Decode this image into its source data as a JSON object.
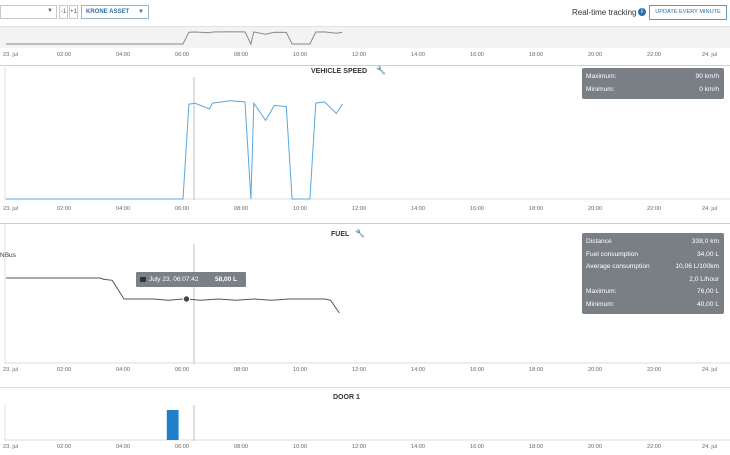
{
  "toolbar": {
    "minus_label": "-1",
    "plus_label": "+1",
    "asset_label": "KRONE ASSET",
    "realtime_label": "Real-time tracking",
    "update_label": "UPDATE EVERY MINUTE",
    "icons": {
      "dropdown": "chevron-down-icon",
      "info": "info-icon",
      "settings": "wrench-icon"
    }
  },
  "axis_ticks": [
    "23. jul",
    "02:00",
    "04:00",
    "06:00",
    "08:00",
    "10:00",
    "12:00",
    "14:00",
    "16:00",
    "18:00",
    "20:00",
    "22:00",
    "24. jul"
  ],
  "speed_panel": {
    "title": "VEHICLE SPEED",
    "stats": [
      {
        "label": "Maximum:",
        "value": "90 km/h"
      },
      {
        "label": "Minimum:",
        "value": "0 km/h"
      }
    ]
  },
  "fuel_panel": {
    "title": "FUEL",
    "series_label": "NBus",
    "tooltip": {
      "date": "July 23, 06:07:42",
      "value": "58,00 L"
    },
    "stats": [
      {
        "label": "Distance",
        "value": "338,0 km"
      },
      {
        "label": "Fuel consumption",
        "value": "34,00 L"
      },
      {
        "label": "Average consumption",
        "value": "10,06 L/100km"
      },
      {
        "label": "",
        "value": "2,0 L/hour"
      },
      {
        "label": "Maximum:",
        "value": "76,00 L"
      },
      {
        "label": "Minimum:",
        "value": "40,00 L"
      }
    ]
  },
  "door_panel": {
    "title": "DOOR 1"
  },
  "colors": {
    "speed_line": "#5aa7e0",
    "fuel_line": "#555555",
    "door_bar": "#1f7fc9",
    "stat_bg": "#7a7f86",
    "accent": "#2a6fae"
  },
  "chart_data": [
    {
      "type": "line",
      "title": "VEHICLE SPEED",
      "unit": "km/h",
      "x_range": [
        "23. jul 00:00",
        "24. jul 00:00"
      ],
      "ylim": [
        0,
        90
      ],
      "x": [
        0,
        6.0,
        6.2,
        6.4,
        6.9,
        7.0,
        7.6,
        8.1,
        8.3,
        8.4,
        8.8,
        9.1,
        9.5,
        9.7,
        10.3,
        10.5,
        10.8,
        11.2,
        11.4
      ],
      "values": [
        0,
        0,
        82,
        83,
        78,
        83,
        85,
        84,
        0,
        83,
        68,
        81,
        80,
        0,
        0,
        83,
        84,
        74,
        82
      ]
    },
    {
      "type": "line",
      "title": "FUEL",
      "unit": "L",
      "x_range": [
        "23. jul 00:00",
        "24. jul 00:00"
      ],
      "ylim": [
        40,
        76
      ],
      "x": [
        0,
        3.2,
        3.3,
        3.6,
        4.0,
        4.6,
        5.0,
        5.5,
        6.0,
        6.12,
        6.6,
        7.2,
        7.8,
        8.4,
        9.0,
        9.6,
        10.2,
        10.8,
        11.0,
        11.3
      ],
      "values": [
        76,
        76,
        75,
        74,
        58,
        58,
        58,
        57,
        58,
        58,
        57,
        58,
        57,
        58,
        57,
        58,
        58,
        58,
        57,
        46
      ]
    },
    {
      "type": "bar",
      "title": "DOOR 1",
      "x_range": [
        "23. jul 00:00",
        "24. jul 00:00"
      ],
      "events": [
        {
          "start": 5.45,
          "end": 5.85,
          "value": 1
        }
      ]
    }
  ]
}
